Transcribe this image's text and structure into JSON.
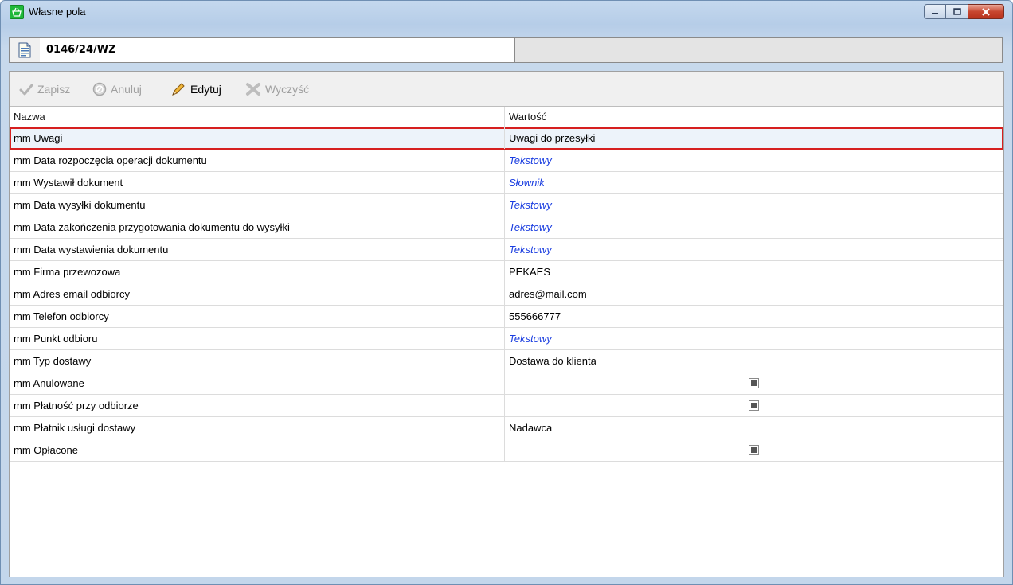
{
  "window": {
    "title": "Własne pola"
  },
  "document": {
    "number": "0146/24/WZ"
  },
  "toolbar": {
    "save_label": "Zapisz",
    "cancel_label": "Anuluj",
    "edit_label": "Edytuj",
    "clear_label": "Wyczyść"
  },
  "grid": {
    "columns": {
      "name": "Nazwa",
      "value": "Wartość"
    },
    "rows": [
      {
        "name": "mm Uwagi",
        "value": "Uwagi do przesyłki",
        "kind": "text",
        "selected": true
      },
      {
        "name": "mm Data rozpoczęcia operacji dokumentu",
        "value": "Tekstowy",
        "kind": "placeholder"
      },
      {
        "name": "mm Wystawił dokument",
        "value": "Słownik",
        "kind": "placeholder"
      },
      {
        "name": "mm Data wysyłki dokumentu",
        "value": "Tekstowy",
        "kind": "placeholder"
      },
      {
        "name": "mm Data zakończenia przygotowania dokumentu do wysyłki",
        "value": "Tekstowy",
        "kind": "placeholder"
      },
      {
        "name": "mm Data wystawienia dokumentu",
        "value": "Tekstowy",
        "kind": "placeholder"
      },
      {
        "name": "mm Firma przewozowa",
        "value": "PEKAES",
        "kind": "text"
      },
      {
        "name": "mm Adres email odbiorcy",
        "value": "adres@mail.com",
        "kind": "text"
      },
      {
        "name": "mm Telefon odbiorcy",
        "value": "555666777",
        "kind": "text"
      },
      {
        "name": "mm Punkt odbioru",
        "value": "Tekstowy",
        "kind": "placeholder"
      },
      {
        "name": "mm Typ dostawy",
        "value": "Dostawa do klienta",
        "kind": "text"
      },
      {
        "name": "mm Anulowane",
        "value": "",
        "kind": "checkbox"
      },
      {
        "name": "mm Płatność przy odbiorze",
        "value": "",
        "kind": "checkbox"
      },
      {
        "name": "mm Płatnik usługi dostawy",
        "value": "Nadawca",
        "kind": "text"
      },
      {
        "name": "mm Opłacone",
        "value": "",
        "kind": "checkbox"
      }
    ]
  },
  "colors": {
    "placeholder_text": "#1a3de0",
    "selection_outline": "#d61f1f",
    "disabled_text": "#a0a0a0"
  }
}
